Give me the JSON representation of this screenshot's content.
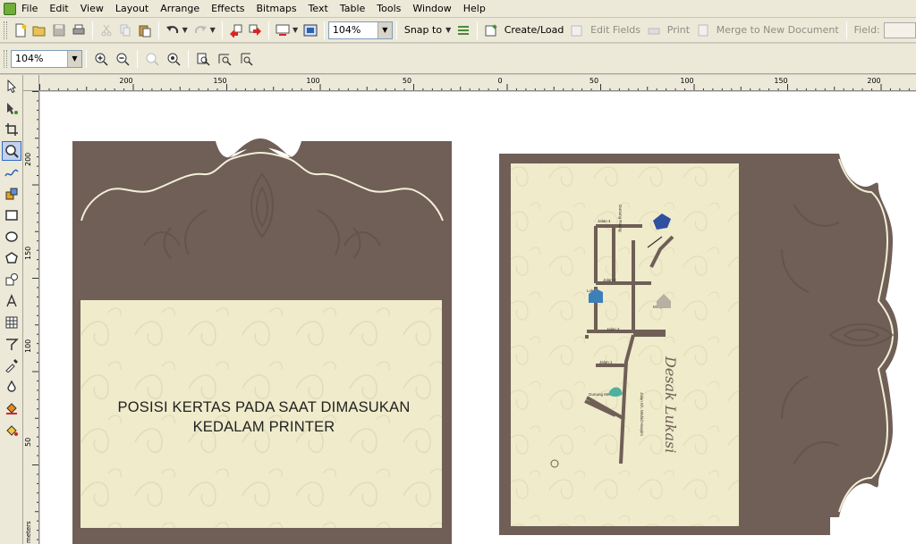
{
  "menu": [
    "File",
    "Edit",
    "View",
    "Layout",
    "Arrange",
    "Effects",
    "Bitmaps",
    "Text",
    "Table",
    "Tools",
    "Window",
    "Help"
  ],
  "toolbar1": {
    "zoom_value": "104%",
    "snap_label": "Snap to",
    "create_load_label": "Create/Load",
    "edit_fields_label": "Edit Fields",
    "print_label": "Print",
    "merge_label": "Merge to New Document",
    "field_label": "Field:"
  },
  "toolbar2": {
    "zoom_value": "104%"
  },
  "ruler": {
    "h_labels": [
      "200",
      "150",
      "100",
      "50",
      "0",
      "50",
      "100",
      "150",
      "200"
    ],
    "v_labels": [
      "200",
      "150",
      "100",
      "50"
    ],
    "unit": "meters"
  },
  "canvas": {
    "left_text_line1": "POSISI KERTAS PADA SAAT DIMASUKAN",
    "left_text_line2": "KEDALAM PRINTER",
    "signature": "Desak Lukasi"
  },
  "map_labels": [
    "Jalan 4",
    "Jalan 3",
    "Jalan 2",
    "Jalan 1",
    "Gunung Merbabu",
    "Jalan Kh. Wahid Hasyim",
    "Masjid",
    "Lokasi",
    "Gunung Raung"
  ],
  "colors": {
    "brown": "#6f5f56",
    "cream": "#efebcb",
    "ivory": "#f2efd8",
    "accent": "#316ac5"
  },
  "icons": {
    "toolbox": [
      "pick-tool-icon",
      "shape-tool-icon",
      "crop-tool-icon",
      "zoom-tool-icon",
      "freehand-tool-icon",
      "smart-fill-icon",
      "rectangle-tool-icon",
      "ellipse-tool-icon",
      "polygon-tool-icon",
      "basic-shapes-icon",
      "text-tool-icon",
      "table-tool-icon",
      "interactive-blend-icon",
      "eyedropper-icon",
      "outline-tool-icon",
      "fill-tool-icon",
      "interactive-fill-icon"
    ]
  }
}
